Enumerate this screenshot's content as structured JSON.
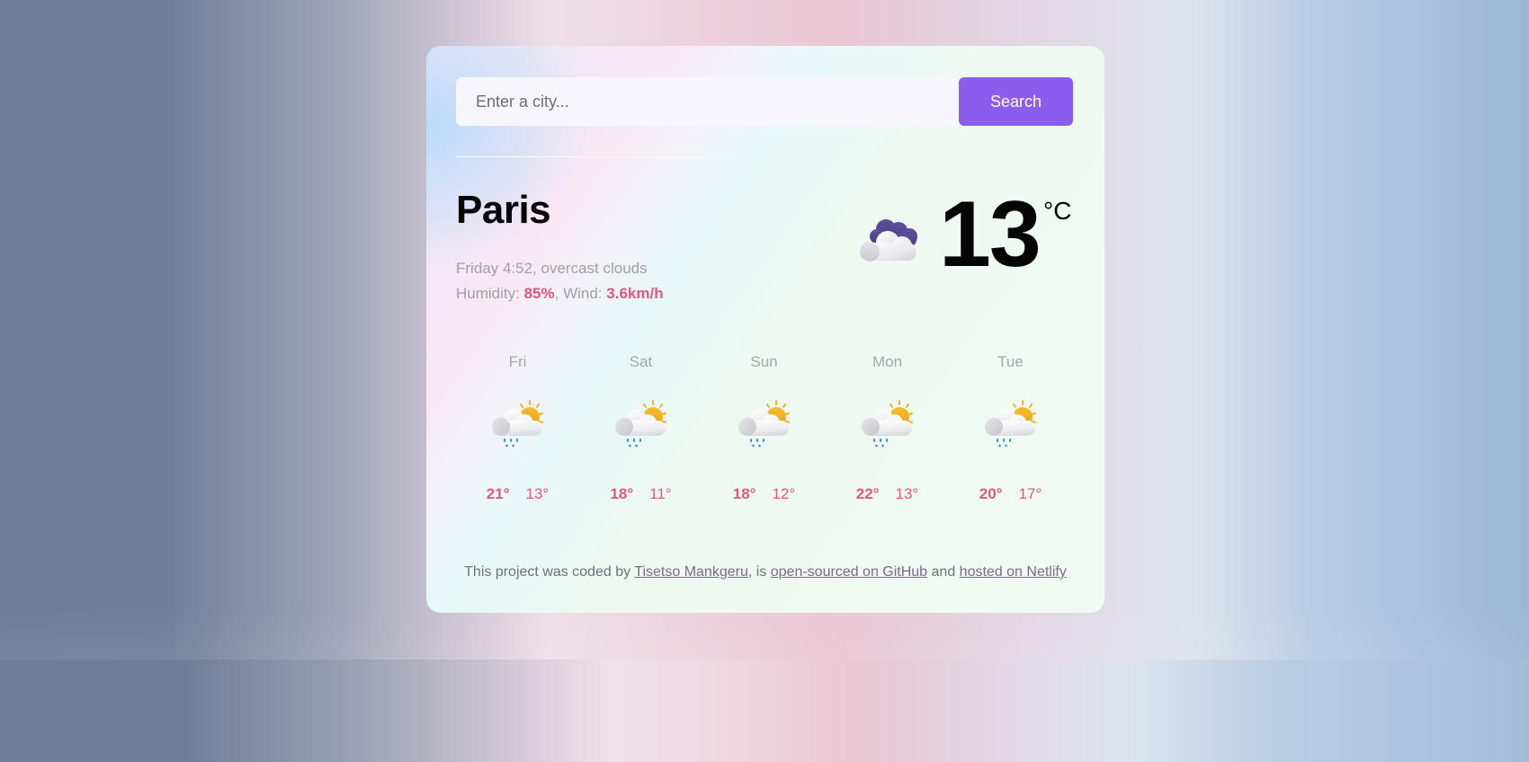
{
  "search": {
    "placeholder": "Enter a city...",
    "value": "",
    "button_label": "Search"
  },
  "current": {
    "city": "Paris",
    "day_time": "Friday 4:52",
    "description": "overcast clouds",
    "humidity_label": "Humidity:",
    "humidity": "85%",
    "wind_label": "Wind:",
    "wind": "3.6km/h",
    "temperature": "13",
    "unit": "°C",
    "icon": "overcast-clouds-icon"
  },
  "forecast": [
    {
      "day": "Fri",
      "max": "21°",
      "min": "13°",
      "icon": "rain-sun-cloud-icon"
    },
    {
      "day": "Sat",
      "max": "18°",
      "min": "11°",
      "icon": "rain-sun-cloud-icon"
    },
    {
      "day": "Sun",
      "max": "18°",
      "min": "12°",
      "icon": "rain-sun-cloud-icon"
    },
    {
      "day": "Mon",
      "max": "22°",
      "min": "13°",
      "icon": "rain-sun-cloud-icon"
    },
    {
      "day": "Tue",
      "max": "20°",
      "min": "17°",
      "icon": "rain-sun-cloud-icon"
    }
  ],
  "footer": {
    "prefix": "This project was coded by ",
    "author_link": "Tisetso Mankgeru",
    "middle": ", is ",
    "github_link": "open-sourced on GitHub",
    "and": " and ",
    "netlify_link": "hosted on Netlify"
  },
  "colors": {
    "accent": "#8b5ced",
    "highlight": "#e2577d"
  }
}
